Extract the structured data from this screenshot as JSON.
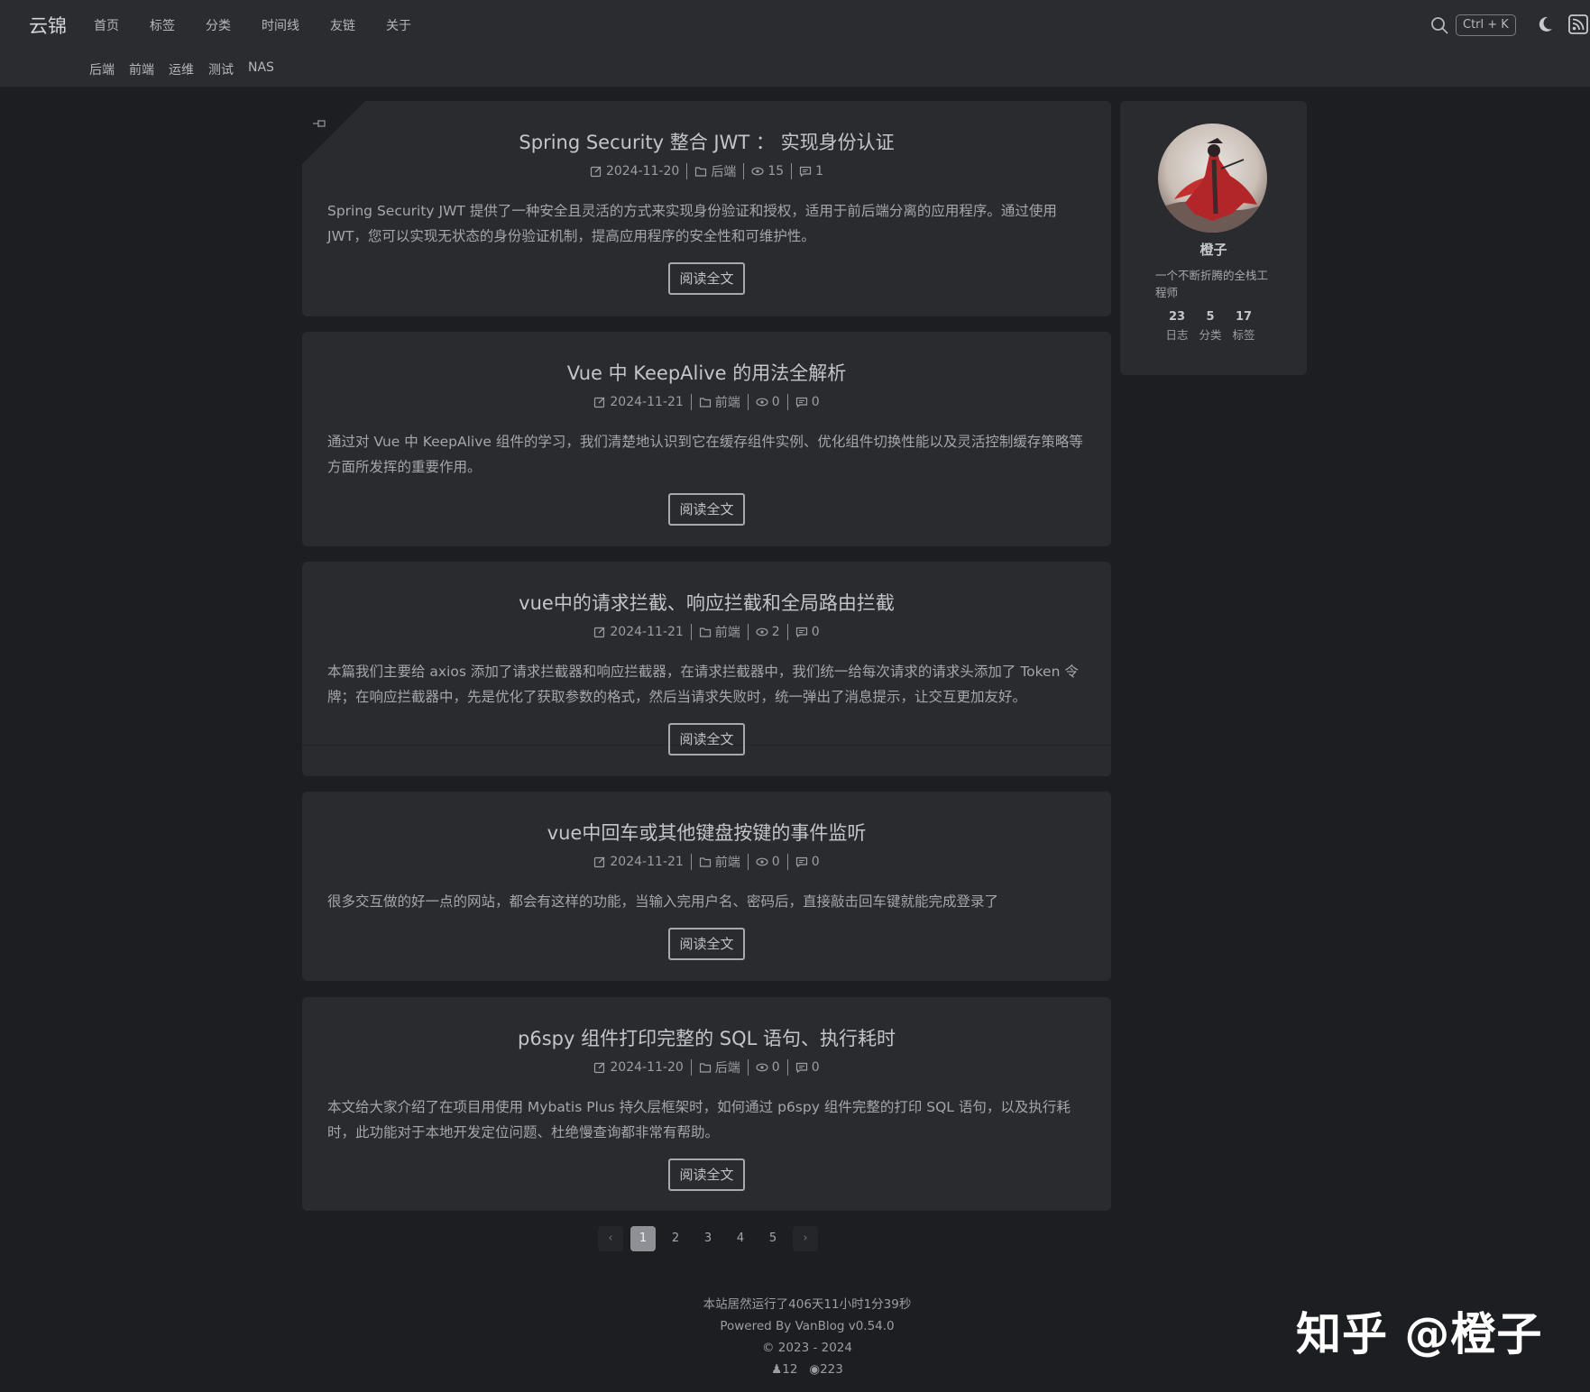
{
  "header": {
    "logo": "云锦",
    "nav": [
      "首页",
      "标签",
      "分类",
      "时间线",
      "友链",
      "关于"
    ],
    "subnav": [
      "后端",
      "前端",
      "运维",
      "测试",
      "NAS"
    ],
    "search_shortcut": "Ctrl + K"
  },
  "posts": [
    {
      "title": "Spring Security 整合 JWT ： 实现身份认证",
      "date": "2024-11-20",
      "category": "后端",
      "views": "15",
      "comments": "1",
      "excerpt": "Spring Security JWT 提供了一种安全且灵活的方式来实现身份验证和授权，适用于前后端分离的应用程序。通过使用 JWT，您可以实现无状态的身份验证机制，提高应用程序的安全性和可维护性。",
      "read_more": "阅读全文"
    },
    {
      "title": "Vue 中 KeepAlive 的用法全解析",
      "date": "2024-11-21",
      "category": "前端",
      "views": "0",
      "comments": "0",
      "excerpt": "通过对 Vue 中 KeepAlive 组件的学习，我们清楚地认识到它在缓存组件实例、优化组件切换性能以及灵活控制缓存策略等方面所发挥的重要作用。",
      "read_more": "阅读全文"
    },
    {
      "title": "vue中的请求拦截、响应拦截和全局路由拦截",
      "date": "2024-11-21",
      "category": "前端",
      "views": "2",
      "comments": "0",
      "excerpt": "本篇我们主要给 axios 添加了请求拦截器和响应拦截器，在请求拦截器中，我们统一给每次请求的请求头添加了 Token 令牌；在响应拦截器中，先是优化了获取参数的格式，然后当请求失败时，统一弹出了消息提示，让交互更加友好。",
      "read_more": "阅读全文"
    },
    {
      "title": "vue中回车或其他键盘按键的事件监听",
      "date": "2024-11-21",
      "category": "前端",
      "views": "0",
      "comments": "0",
      "excerpt": "很多交互做的好一点的网站，都会有这样的功能，当输入完用户名、密码后，直接敲击回车键就能完成登录了",
      "read_more": "阅读全文"
    },
    {
      "title": "p6spy 组件打印完整的 SQL 语句、执行耗时",
      "date": "2024-11-20",
      "category": "后端",
      "views": "0",
      "comments": "0",
      "excerpt": "本文给大家介绍了在项目用使用 Mybatis Plus 持久层框架时，如何通过 p6spy 组件完整的打印 SQL 语句，以及执行耗时，此功能对于本地开发定位问题、杜绝慢查询都非常有帮助。",
      "read_more": "阅读全文"
    }
  ],
  "profile": {
    "name": "橙子",
    "bio": "一个不断折腾的全栈工程师",
    "stats": [
      {
        "num": "23",
        "label": "日志"
      },
      {
        "num": "5",
        "label": "分类"
      },
      {
        "num": "17",
        "label": "标签"
      }
    ]
  },
  "pagination": {
    "prev": "‹",
    "pages": [
      "1",
      "2",
      "3",
      "4",
      "5"
    ],
    "active": "1",
    "next": "›"
  },
  "footer": {
    "uptime": "本站居然运行了406天11小时1分39秒",
    "powered": "Powered By VanBlog v0.54.0",
    "copyright": "© 2023 - 2024",
    "visitors": "12",
    "pageviews": "223"
  },
  "watermark": "知乎 @橙子"
}
